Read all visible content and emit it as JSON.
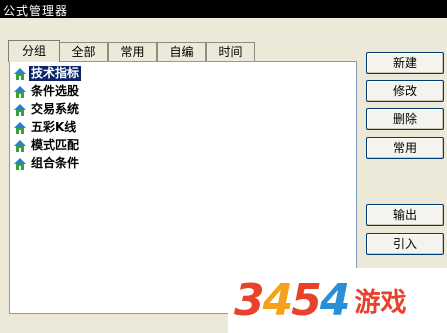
{
  "window": {
    "title": "公式管理器"
  },
  "tabs": [
    "分组",
    "全部",
    "常用",
    "自编",
    "时间"
  ],
  "tree": [
    {
      "label": "技术指标",
      "selected": true
    },
    {
      "label": "条件选股",
      "selected": false
    },
    {
      "label": "交易系统",
      "selected": false
    },
    {
      "label": "五彩K线",
      "selected": false
    },
    {
      "label": "模式匹配",
      "selected": false
    },
    {
      "label": "组合条件",
      "selected": false
    }
  ],
  "buttons": {
    "new": "新建",
    "modify": "修改",
    "delete": "删除",
    "common": "常用",
    "export": "输出",
    "import": "引入"
  },
  "watermark": {
    "digits": [
      "3",
      "4",
      "5",
      "4"
    ],
    "text": "游戏"
  },
  "colors": {
    "selection": "#0a246a",
    "icon_roof": "#2b7fd0",
    "icon_body": "#3aa23a"
  }
}
